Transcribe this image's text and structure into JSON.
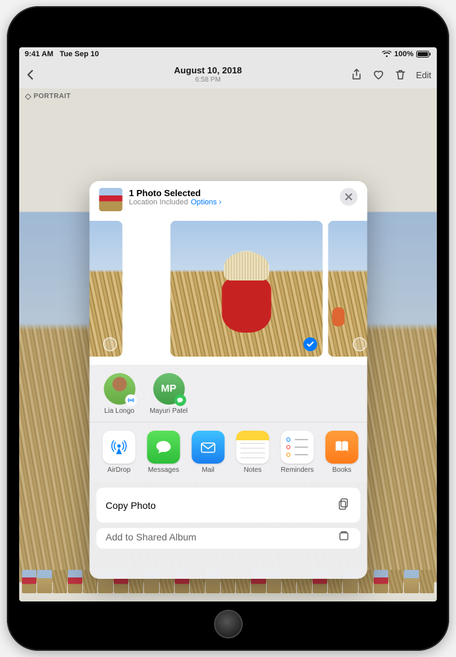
{
  "status_bar": {
    "time": "9:41 AM",
    "date": "Tue Sep 10",
    "battery_pct": "100%"
  },
  "nav": {
    "title": "August 10, 2018",
    "subtitle": "6:58 PM",
    "edit_label": "Edit",
    "portrait_badge": "PORTRAIT"
  },
  "share_sheet": {
    "header": {
      "title": "1 Photo Selected",
      "subtitle_prefix": "Location Included",
      "options_label": "Options"
    },
    "previews": [
      {
        "selected": false
      },
      {
        "selected": true
      },
      {
        "selected": false
      }
    ],
    "contacts": [
      {
        "name": "Lia Longo",
        "type": "photo",
        "badge": "airdrop"
      },
      {
        "name": "Mayuri Patel",
        "type": "initials",
        "initials": "MP",
        "badge": "messages"
      }
    ],
    "apps": [
      {
        "label": "AirDrop",
        "icon": "airdrop"
      },
      {
        "label": "Messages",
        "icon": "messages"
      },
      {
        "label": "Mail",
        "icon": "mail"
      },
      {
        "label": "Notes",
        "icon": "notes"
      },
      {
        "label": "Reminders",
        "icon": "reminders"
      },
      {
        "label": "Books",
        "icon": "books"
      }
    ],
    "actions": [
      {
        "label": "Copy Photo",
        "icon": "copy"
      },
      {
        "label": "Add to Shared Album",
        "icon": "shared-album"
      }
    ]
  }
}
